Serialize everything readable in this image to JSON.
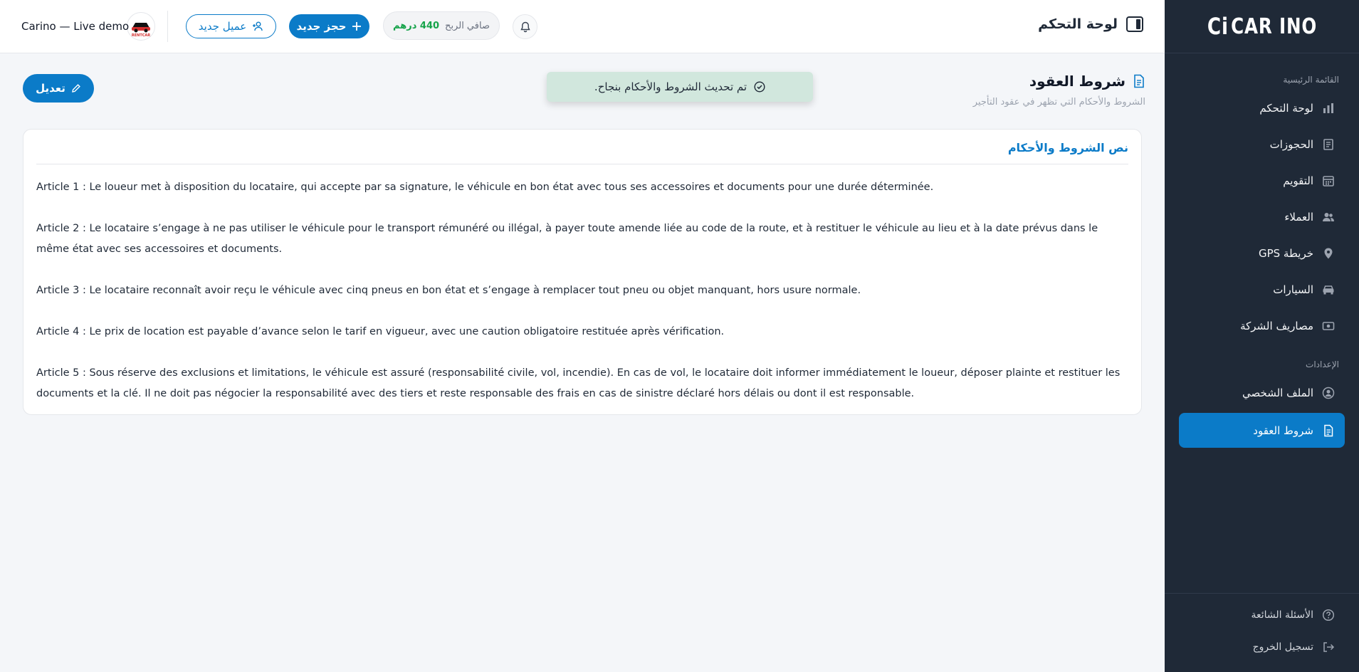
{
  "sidebar": {
    "logo_text": "CAR INO",
    "main_section_title": "القائمة الرئيسية",
    "main_items": [
      {
        "label": "لوحة التحكم",
        "icon": "chart-bar-icon"
      },
      {
        "label": "الحجوزات",
        "icon": "receipt-icon"
      },
      {
        "label": "التقويم",
        "icon": "calendar-icon"
      },
      {
        "label": "العملاء",
        "icon": "users-icon"
      },
      {
        "label": "خريطة GPS",
        "icon": "map-pin-icon"
      },
      {
        "label": "السيارات",
        "icon": "car-icon"
      },
      {
        "label": "مصاريف الشركة",
        "icon": "money-icon"
      }
    ],
    "settings_section_title": "الإعدادات",
    "settings_items": [
      {
        "label": "الملف الشخصي",
        "icon": "user-circle-icon"
      },
      {
        "label": "شروط العقود",
        "icon": "document-icon",
        "active": true
      }
    ],
    "bottom_items": [
      {
        "label": "الأسئلة الشائعة",
        "icon": "help-circle-icon"
      },
      {
        "label": "تسجيل الخروج",
        "icon": "logout-icon"
      }
    ]
  },
  "topbar": {
    "title": "لوحة التحكم",
    "profit_label": "صافي الربح",
    "profit_value": "440 درهم",
    "new_booking_label": "حجز جديد",
    "new_client_label": "عميل جديد",
    "company_name": "Carino — Live demo",
    "company_logo_text": "RENTCAR"
  },
  "page": {
    "title": "شروط العقود",
    "subtitle": "الشروط والأحكام التي تظهر في عقود التأجير",
    "toast": "تم تحديث الشروط والأحكام بنجاح.",
    "edit_label": "تعديل"
  },
  "card": {
    "title": "نص الشروط والأحكام",
    "articles": [
      "Article 1 : Le loueur met à disposition du locataire, qui accepte par sa signature, le véhicule en bon état avec tous ses accessoires et documents pour une durée déterminée.",
      "Article 2 : Le locataire s’engage à ne pas utiliser le véhicule pour le transport rémunéré ou illégal, à payer toute amende liée au code de la route, et à restituer le véhicule au lieu et à la date prévus dans le même état avec ses accessoires et documents.",
      "Article 3 : Le locataire reconnaît avoir reçu le véhicule avec cinq pneus en bon état et s’engage à remplacer tout pneu ou objet manquant, hors usure normale.",
      "Article 4 : Le prix de location est payable d’avance selon le tarif en vigueur, avec une caution obligatoire restituée après vérification.",
      "Article 5 : Sous réserve des exclusions et limitations, le véhicule est assuré (responsabilité civile, vol, incendie). En cas de vol, le locataire doit informer immédiatement le loueur, déposer plainte et restituer les documents et la clé. Il ne doit pas négocier la responsabilité avec des tiers et reste responsable des frais en cas de sinistre déclaré hors délais ou dont il est responsable."
    ]
  },
  "colors": {
    "accent": "#0b7bc8",
    "sidebar_bg": "#1f2937",
    "toast_bg": "#d1e7dd",
    "profit_green": "#16a34a"
  }
}
